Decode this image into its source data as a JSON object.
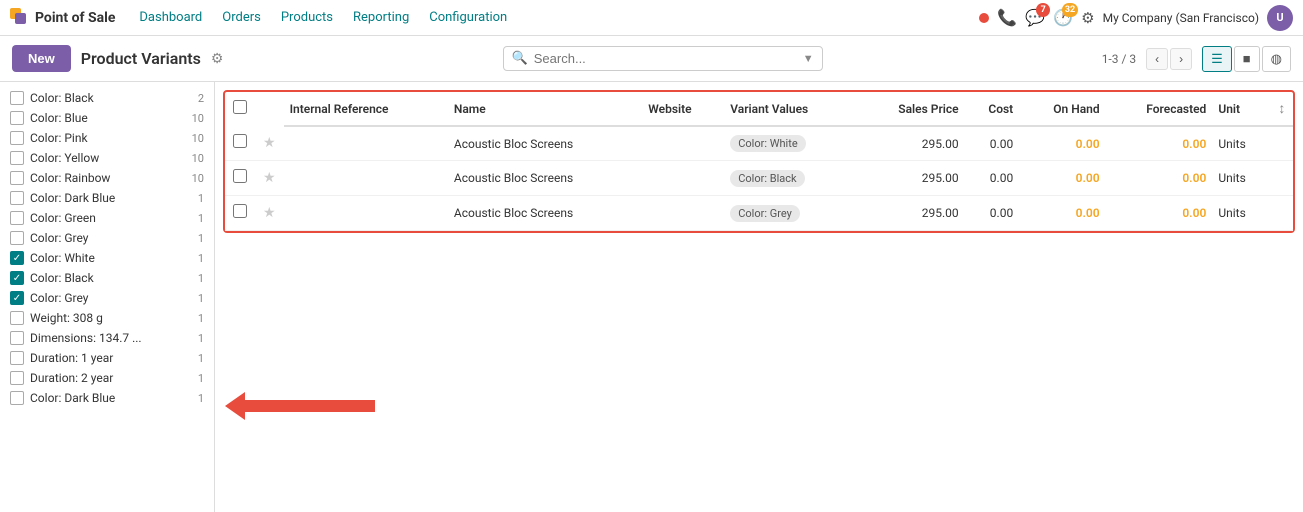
{
  "brand": {
    "name": "Point of Sale"
  },
  "nav": {
    "links": [
      "Dashboard",
      "Orders",
      "Products",
      "Reporting",
      "Configuration"
    ],
    "company": "My Company (San Francisco)",
    "badges": {
      "chat": "7",
      "activity": "32"
    }
  },
  "subheader": {
    "new_label": "New",
    "title": "Product Variants",
    "search_placeholder": "Search...",
    "pagination": "1-3 / 3"
  },
  "sidebar": {
    "items": [
      {
        "label": "Color: Black",
        "count": "2",
        "checked": false
      },
      {
        "label": "Color: Blue",
        "count": "10",
        "checked": false
      },
      {
        "label": "Color: Pink",
        "count": "10",
        "checked": false
      },
      {
        "label": "Color: Yellow",
        "count": "10",
        "checked": false
      },
      {
        "label": "Color: Rainbow",
        "count": "10",
        "checked": false
      },
      {
        "label": "Color: Dark Blue",
        "count": "1",
        "checked": false
      },
      {
        "label": "Color: Green",
        "count": "1",
        "checked": false
      },
      {
        "label": "Color: Grey",
        "count": "1",
        "checked": false
      },
      {
        "label": "Color: White",
        "count": "1",
        "checked": true
      },
      {
        "label": "Color: Black",
        "count": "1",
        "checked": true
      },
      {
        "label": "Color: Grey",
        "count": "1",
        "checked": true
      },
      {
        "label": "Weight: 308 g",
        "count": "1",
        "checked": false
      },
      {
        "label": "Dimensions: 134.7 ...",
        "count": "1",
        "checked": false
      },
      {
        "label": "Duration: 1 year",
        "count": "1",
        "checked": false
      },
      {
        "label": "Duration: 2 year",
        "count": "1",
        "checked": false
      },
      {
        "label": "Color: Dark Blue",
        "count": "1",
        "checked": false
      }
    ]
  },
  "table": {
    "columns": [
      "",
      "",
      "Internal Reference",
      "Name",
      "Website",
      "Variant Values",
      "Sales Price",
      "Cost",
      "On Hand",
      "Forecasted",
      "Unit"
    ],
    "rows": [
      {
        "name": "Acoustic Bloc Screens",
        "website": "",
        "variant": "Color: White",
        "sales_price": "295.00",
        "cost": "0.00",
        "on_hand": "0.00",
        "forecasted": "0.00",
        "unit": "Units"
      },
      {
        "name": "Acoustic Bloc Screens",
        "website": "",
        "variant": "Color: Black",
        "sales_price": "295.00",
        "cost": "0.00",
        "on_hand": "0.00",
        "forecasted": "0.00",
        "unit": "Units"
      },
      {
        "name": "Acoustic Bloc Screens",
        "website": "",
        "variant": "Color: Grey",
        "sales_price": "295.00",
        "cost": "0.00",
        "on_hand": "0.00",
        "forecasted": "0.00",
        "unit": "Units"
      }
    ]
  }
}
